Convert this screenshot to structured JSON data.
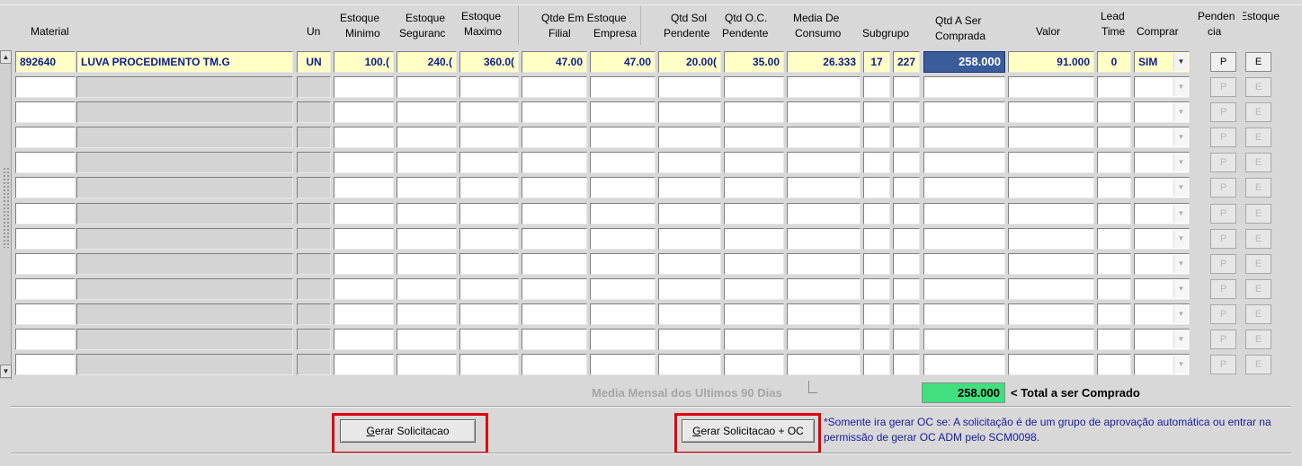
{
  "headers": {
    "material": "Material",
    "un": "Un",
    "estoque_minimo": [
      "Estoque",
      "Minimo"
    ],
    "estoque_seguranca": [
      "Estoque",
      "Seguranc"
    ],
    "estoque_maximo": [
      "Estoque",
      "Maximo"
    ],
    "qtde_em_estoque": "Qtde Em Estoque",
    "filial": "Filial",
    "empresa": "Empresa",
    "qtd_sol_pendente": [
      "Qtd Sol",
      "Pendente"
    ],
    "qtd_oc_pendente": [
      "Qtd O.C.",
      "Pendente"
    ],
    "media_consumo": [
      "Media De",
      "Consumo"
    ],
    "subgrupo": "Subgrupo",
    "qtd_a_ser_comprada": [
      "Qtd A Ser",
      "Comprada"
    ],
    "valor": "Valor",
    "lead_time": [
      "Lead",
      "Time"
    ],
    "comprar": "Comprar",
    "pendencia": [
      "Penden",
      "cia"
    ],
    "estoque": "Estoque"
  },
  "rows": [
    {
      "codigo": "892640",
      "descricao": "LUVA PROCEDIMENTO TM.G",
      "un": "UN",
      "est_min": "100.(",
      "est_seg": "240.(",
      "est_max": "360.0(",
      "filial": "47.00",
      "empresa": "47.00",
      "sol_pend": "20.00(",
      "oc_pend": "35.00",
      "media": "26.333",
      "subgrupo1": "17",
      "subgrupo2": "227",
      "qtd_comprada": "258.000",
      "valor": "91.000",
      "lead": "0",
      "comprar": "SIM",
      "btn_p": "P",
      "btn_e": "E"
    }
  ],
  "empty_row_button_labels": {
    "p": "P",
    "e": "E"
  },
  "footer": {
    "media_label": "Media Mensal dos Ultimos 90 Dias",
    "total_value": "258.000",
    "total_label": "< Total a ser Comprado"
  },
  "buttons": {
    "gerar_solicitacao_mnemonic": "G",
    "gerar_solicitacao_rest": "erar Solicitacao",
    "gerar_solicitacao_oc_mnemonic": "G",
    "gerar_solicitacao_oc_rest": "erar Solicitacao + OC"
  },
  "note": "*Somente ira gerar OC se: A solicitação é de um grupo de aprovação automática ou entrar na permissão de gerar OC ADM pelo SCM0098.",
  "colors": {
    "active_row_bg": "#ffffc6",
    "active_row_text": "#0b1d8c",
    "selected_cell": "#3a5c9a",
    "total_green": "#3fe07d",
    "highlight_red": "#e0000b",
    "note_text": "#1a1aa0"
  },
  "icons": {
    "scroll_up": "triangle-up-icon",
    "scroll_down": "triangle-down-icon",
    "combo": "chevron-down-icon"
  }
}
